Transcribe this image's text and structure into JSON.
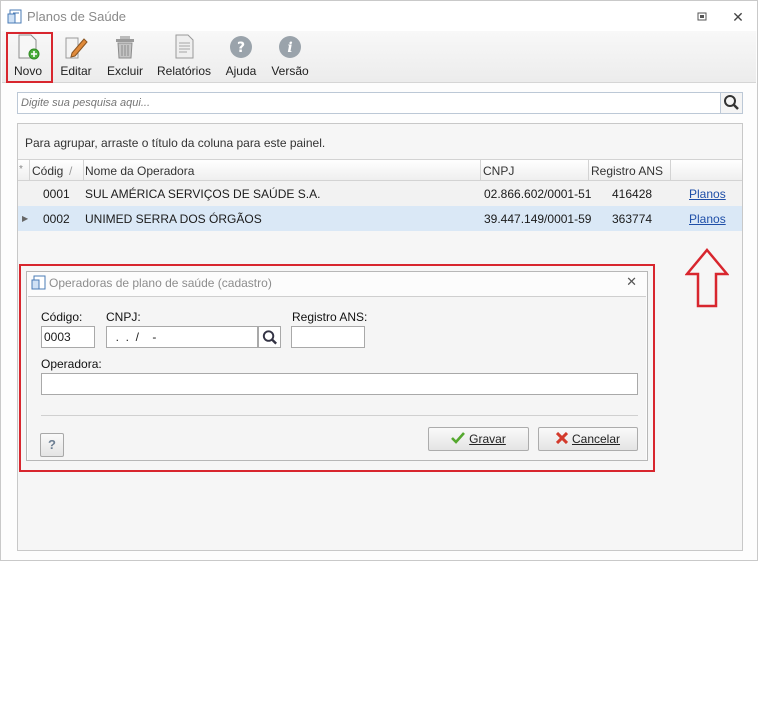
{
  "window": {
    "title": "Planos de Saúde",
    "restore_icon": "restore-window-icon",
    "close_icon": "close-icon",
    "close_glyph": "✕"
  },
  "toolbar": {
    "buttons": [
      {
        "label": "Novo",
        "icon": "new-document-icon",
        "highlighted": true
      },
      {
        "label": "Editar",
        "icon": "pencil-icon"
      },
      {
        "label": "Excluir",
        "icon": "trash-icon"
      },
      {
        "label": "Relatórios",
        "icon": "report-icon"
      },
      {
        "label": "Ajuda",
        "icon": "question-circle-icon"
      },
      {
        "label": "Versão",
        "icon": "info-circle-icon"
      }
    ]
  },
  "search": {
    "placeholder": "Digite sua pesquisa aqui...",
    "icon": "search-icon"
  },
  "grid": {
    "group_hint": "Para agrupar, arraste o título da coluna para este painel.",
    "header_marker": "*",
    "columns": [
      "Códig",
      "Nome da Operadora",
      "CNPJ",
      "Registro ANS"
    ],
    "sort_glyph": "/",
    "rows": [
      {
        "code": "0001",
        "name": "SUL AMÉRICA SERVIÇOS DE SAÚDE S.A.",
        "cnpj": "02.866.602/0001-51",
        "ans": "416428",
        "link": "Planos"
      },
      {
        "code": "0002",
        "name": "UNIMED SERRA DOS ÓRGÃOS",
        "cnpj": "39.447.149/0001-59",
        "ans": "363774",
        "link": "Planos",
        "selected": true
      }
    ],
    "row_pointer": "▶"
  },
  "dialog": {
    "title": "Operadoras de plano de saúde (cadastro)",
    "close_glyph": "✕",
    "fields": {
      "codigo_label": "Código:",
      "codigo_value": "0003",
      "cnpj_label": "CNPJ:",
      "cnpj_value": "  .  .  /    -",
      "registro_label": "Registro ANS:",
      "registro_value": "",
      "operadora_label": "Operadora:",
      "operadora_value": ""
    },
    "help_label": "?",
    "save_label": "Gravar",
    "cancel_label": "Cancelar"
  },
  "colors": {
    "highlight": "#d8262e",
    "selection": "#dae8f6",
    "link": "#1f4fa8"
  }
}
